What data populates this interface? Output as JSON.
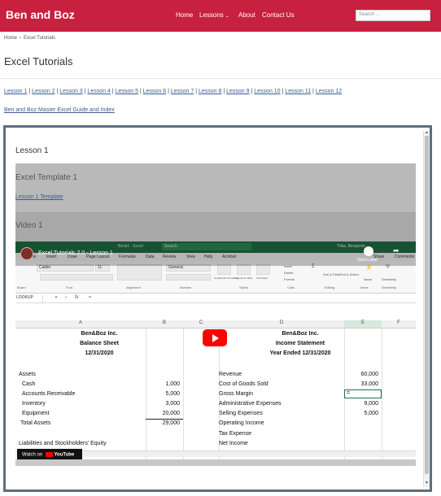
{
  "header": {
    "brand": "Ben and Boz",
    "nav": [
      "Home",
      "Lessons",
      "About",
      "Contact Us"
    ],
    "search_placeholder": "Search ..."
  },
  "breadcrumb": {
    "home": "Home",
    "sep": "›",
    "current": "Excel Tutorials"
  },
  "page": {
    "title": "Excel Tutorials",
    "lessons": [
      "Lesson 1",
      "Lesson 2",
      "Lesson 3",
      "Lesson 4",
      "Lesson 5",
      "Lesson 6",
      "Lesson 7",
      "Lesson 8",
      "Lesson 9",
      "Lesson 10",
      "Lesson 11",
      "Lesson 12"
    ],
    "guide_link": "Ben and Boz Master Excel Guide and Index"
  },
  "frame": {
    "heading": "Lesson 1",
    "template_title": "Excel Template 1",
    "template_link": "Lesson 1 Template",
    "video_heading": "Video 1"
  },
  "video": {
    "title": "Excel Tutorials 2.0 - Lesson 1",
    "watch_later": "Watch later",
    "share": "Share",
    "watch_on": "Watch on",
    "youtube": "YouTube",
    "excel": {
      "window_title": "Book1 - Excel",
      "search": "Search",
      "user": "Trika, Benjamin",
      "tabs": [
        "Home",
        "Insert",
        "Draw",
        "Page Layout",
        "Formulas",
        "Data",
        "Review",
        "View",
        "Help",
        "Acrobat"
      ],
      "comments": "Comments",
      "font_name": "Calibri",
      "font_size": "11",
      "number_format": "General",
      "groups": [
        "Board",
        "Font",
        "Alignment",
        "Number",
        "Styles",
        "Cells",
        "Editing",
        "Ideas",
        "Sensitivity"
      ],
      "style_buttons": [
        "Conditional Formatting",
        "Format as Table",
        "Cell Styles"
      ],
      "cell_buttons": [
        "Insert",
        "Delete",
        "Format"
      ],
      "edit_buttons": [
        "Sort & Filter",
        "Find & Select"
      ],
      "ideas_label": "Ideas",
      "sensitivity_label": "Sensitivity",
      "name_box": "LOOKUP",
      "formula_x": "✕",
      "formula_check": "✓",
      "fx": "fx",
      "formula_value": "=",
      "columns": [
        "A",
        "B",
        "C",
        "D",
        "E",
        "F"
      ],
      "left_company": "Ben&Boz Inc.",
      "left_report": "Balance Sheet",
      "left_date": "12/31/2020",
      "right_company": "Ben&Boz Inc.",
      "right_report": "Income Statement",
      "right_date": "Year Ended 12/31/2020",
      "assets_header": "Assets",
      "assets": [
        {
          "label": "Cash",
          "value": "1,000"
        },
        {
          "label": "Accounts Receivable",
          "value": "5,000"
        },
        {
          "label": "Inventory",
          "value": "3,000"
        },
        {
          "label": "Equipment",
          "value": "20,000"
        },
        {
          "label": "Total Assets",
          "value": "29,000"
        }
      ],
      "liabilities_header": "Liabilities and Stockholders' Equity",
      "income": [
        {
          "label": "Revenue",
          "value": "60,000"
        },
        {
          "label": "Cost of Goods Sold",
          "value": "33,000"
        },
        {
          "label": "Gross Margin",
          "value": "="
        },
        {
          "label": "Administrative Expenses",
          "value": "9,000"
        },
        {
          "label": "Selling Expenses",
          "value": "5,000"
        },
        {
          "label": "Operating Income",
          "value": ""
        },
        {
          "label": "Tax Expense",
          "value": ""
        },
        {
          "label": "Net Income",
          "value": ""
        }
      ]
    }
  },
  "colors": {
    "brand_red": "#c8203f",
    "excel_green": "#1f6e43",
    "link_blue": "#3b5b91",
    "frame_border": "#5b6f7f"
  }
}
